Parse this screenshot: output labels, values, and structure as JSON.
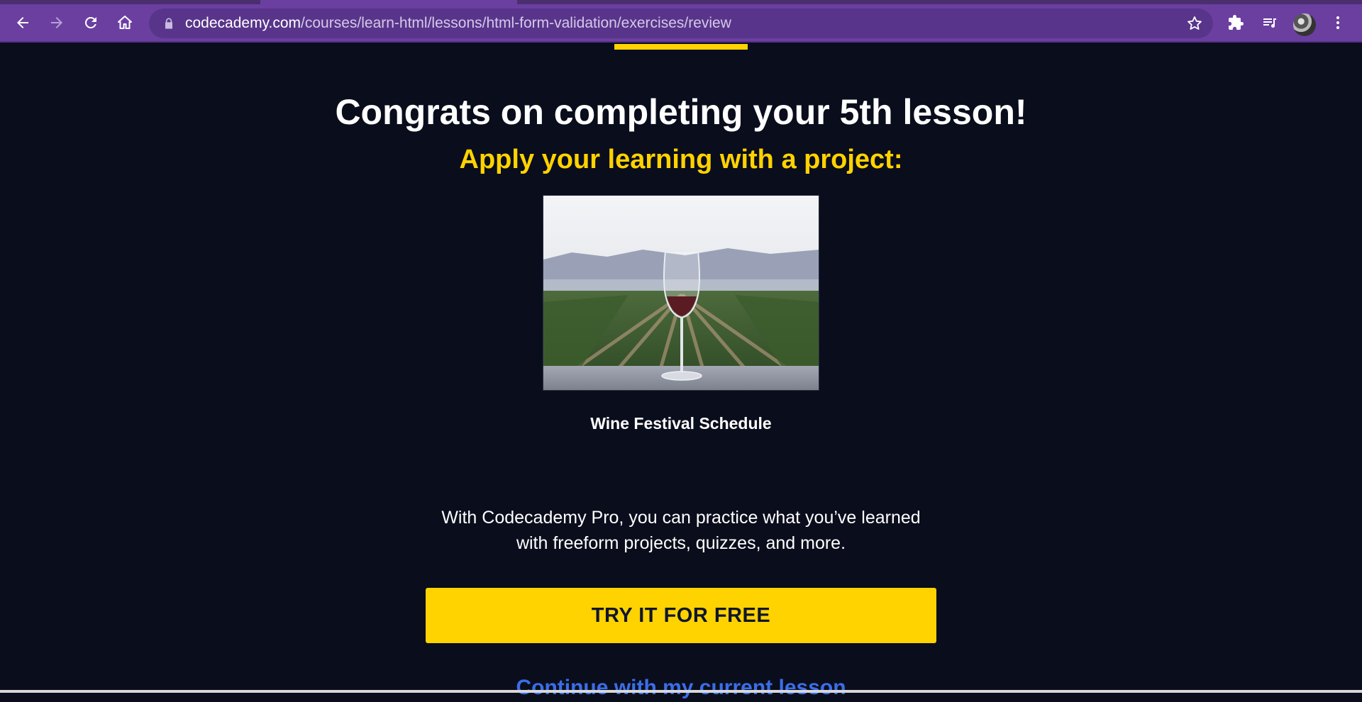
{
  "browser": {
    "url_host": "codecademy.com",
    "url_path": "/courses/learn-html/lessons/html-form-validation/exercises/review",
    "icons": {
      "back": "back-arrow-icon",
      "forward": "forward-arrow-icon",
      "reload": "reload-icon",
      "home": "home-icon",
      "lock": "lock-icon",
      "bookmark": "star-icon",
      "extensions": "puzzle-icon",
      "media": "playlist-icon",
      "menu": "kebab-menu-icon"
    },
    "colors": {
      "frame": "#6b3fa0",
      "omnibox": "#58358a"
    }
  },
  "main": {
    "headline": "Congrats on completing your 5th lesson!",
    "subheadline": "Apply your learning with a project:",
    "project": {
      "title": "Wine Festival Schedule"
    },
    "pro_text_line1": "With Codecademy Pro, you can practice what you’ve learned",
    "pro_text_line2": "with freeform projects, quizzes, and more.",
    "cta_label": "TRY IT FOR FREE",
    "continue_label": "Continue with my current lesson"
  },
  "theme": {
    "background": "#0a0d1c",
    "accent_yellow": "#ffd300",
    "link_blue": "#3a6ee8",
    "text": "#ffffff"
  }
}
